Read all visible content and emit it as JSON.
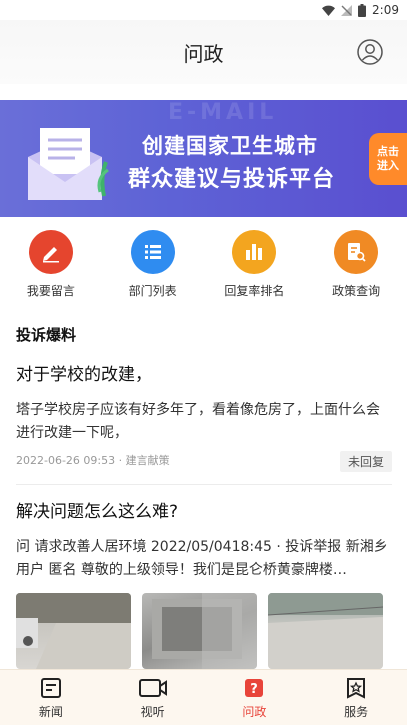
{
  "status_bar": {
    "time": "2:09"
  },
  "header": {
    "title": "问政"
  },
  "banner": {
    "watermark": "E-MAIL",
    "line1": "创建国家卫生城市",
    "line2": "群众建议与投诉平台",
    "cta_line1": "点击",
    "cta_line2": "进入"
  },
  "quick_nav": [
    {
      "label": "我要留言",
      "color": "#e5452e",
      "icon": "pen-icon"
    },
    {
      "label": "部门列表",
      "color": "#2f8cf0",
      "icon": "list-icon"
    },
    {
      "label": "回复率排名",
      "color": "#f3a51f",
      "icon": "bar-chart-icon"
    },
    {
      "label": "政策查询",
      "color": "#f08a24",
      "icon": "document-search-icon"
    }
  ],
  "section": {
    "title": "投诉爆料"
  },
  "articles": [
    {
      "title": "对于学校的改建，",
      "body": "塔子学校房子应该有好多年了，看着像危房了，上面什么会进行改建一下呢，",
      "date": "2022-06-26 09:53",
      "category": "建言献策",
      "status": "未回复"
    },
    {
      "title": "解决问题怎么这么难?",
      "body": "问 请求改善人居环境 2022/05/0418:45 · 投诉举报 新湘乡用户 匿名 尊敬的上级领导！我们是昆仑桥黄豪牌楼…"
    }
  ],
  "tabs": [
    {
      "label": "新闻",
      "icon": "news-icon"
    },
    {
      "label": "视听",
      "icon": "video-icon"
    },
    {
      "label": "问政",
      "icon": "question-icon"
    },
    {
      "label": "服务",
      "icon": "star-badge-icon"
    }
  ],
  "colors": {
    "accent": "#e8443a",
    "banner": "#5e63d6",
    "cta": "#ff8a2a"
  }
}
